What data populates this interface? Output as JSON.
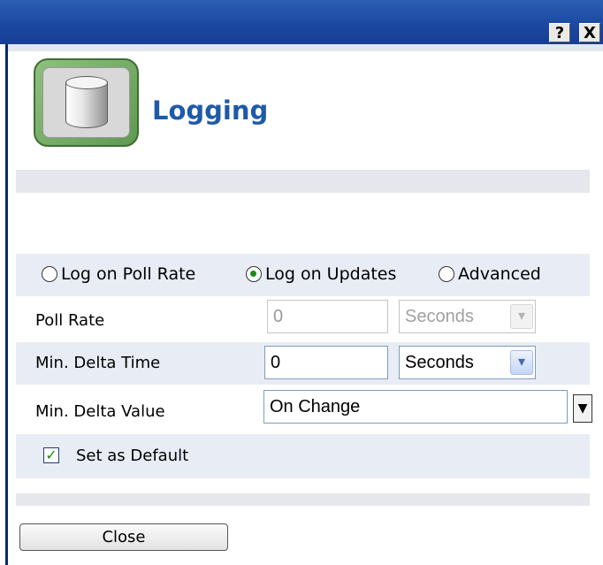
{
  "window": {
    "help_glyph": "?",
    "close_glyph": "X"
  },
  "header": {
    "title": "Logging",
    "icon": "database-cylinder-icon"
  },
  "mode": {
    "options": [
      {
        "label": "Log on Poll Rate",
        "selected": false
      },
      {
        "label": "Log on Updates",
        "selected": true
      },
      {
        "label": "Advanced",
        "selected": false
      }
    ]
  },
  "fields": {
    "poll_rate": {
      "label": "Poll Rate",
      "value": "0",
      "unit": "Seconds",
      "disabled": true
    },
    "min_delta_time": {
      "label": "Min. Delta Time",
      "value": "0",
      "unit": "Seconds"
    },
    "min_delta_value": {
      "label": "Min. Delta Value",
      "value": "On Change"
    }
  },
  "default": {
    "label": "Set as Default",
    "checked": true
  },
  "footer": {
    "close_label": "Close"
  },
  "colors": {
    "title_bar": "#1a47a0",
    "accent_title": "#1f5aa8",
    "row_alt": "#e8ecf4",
    "icon_green": "#6ea85f"
  }
}
